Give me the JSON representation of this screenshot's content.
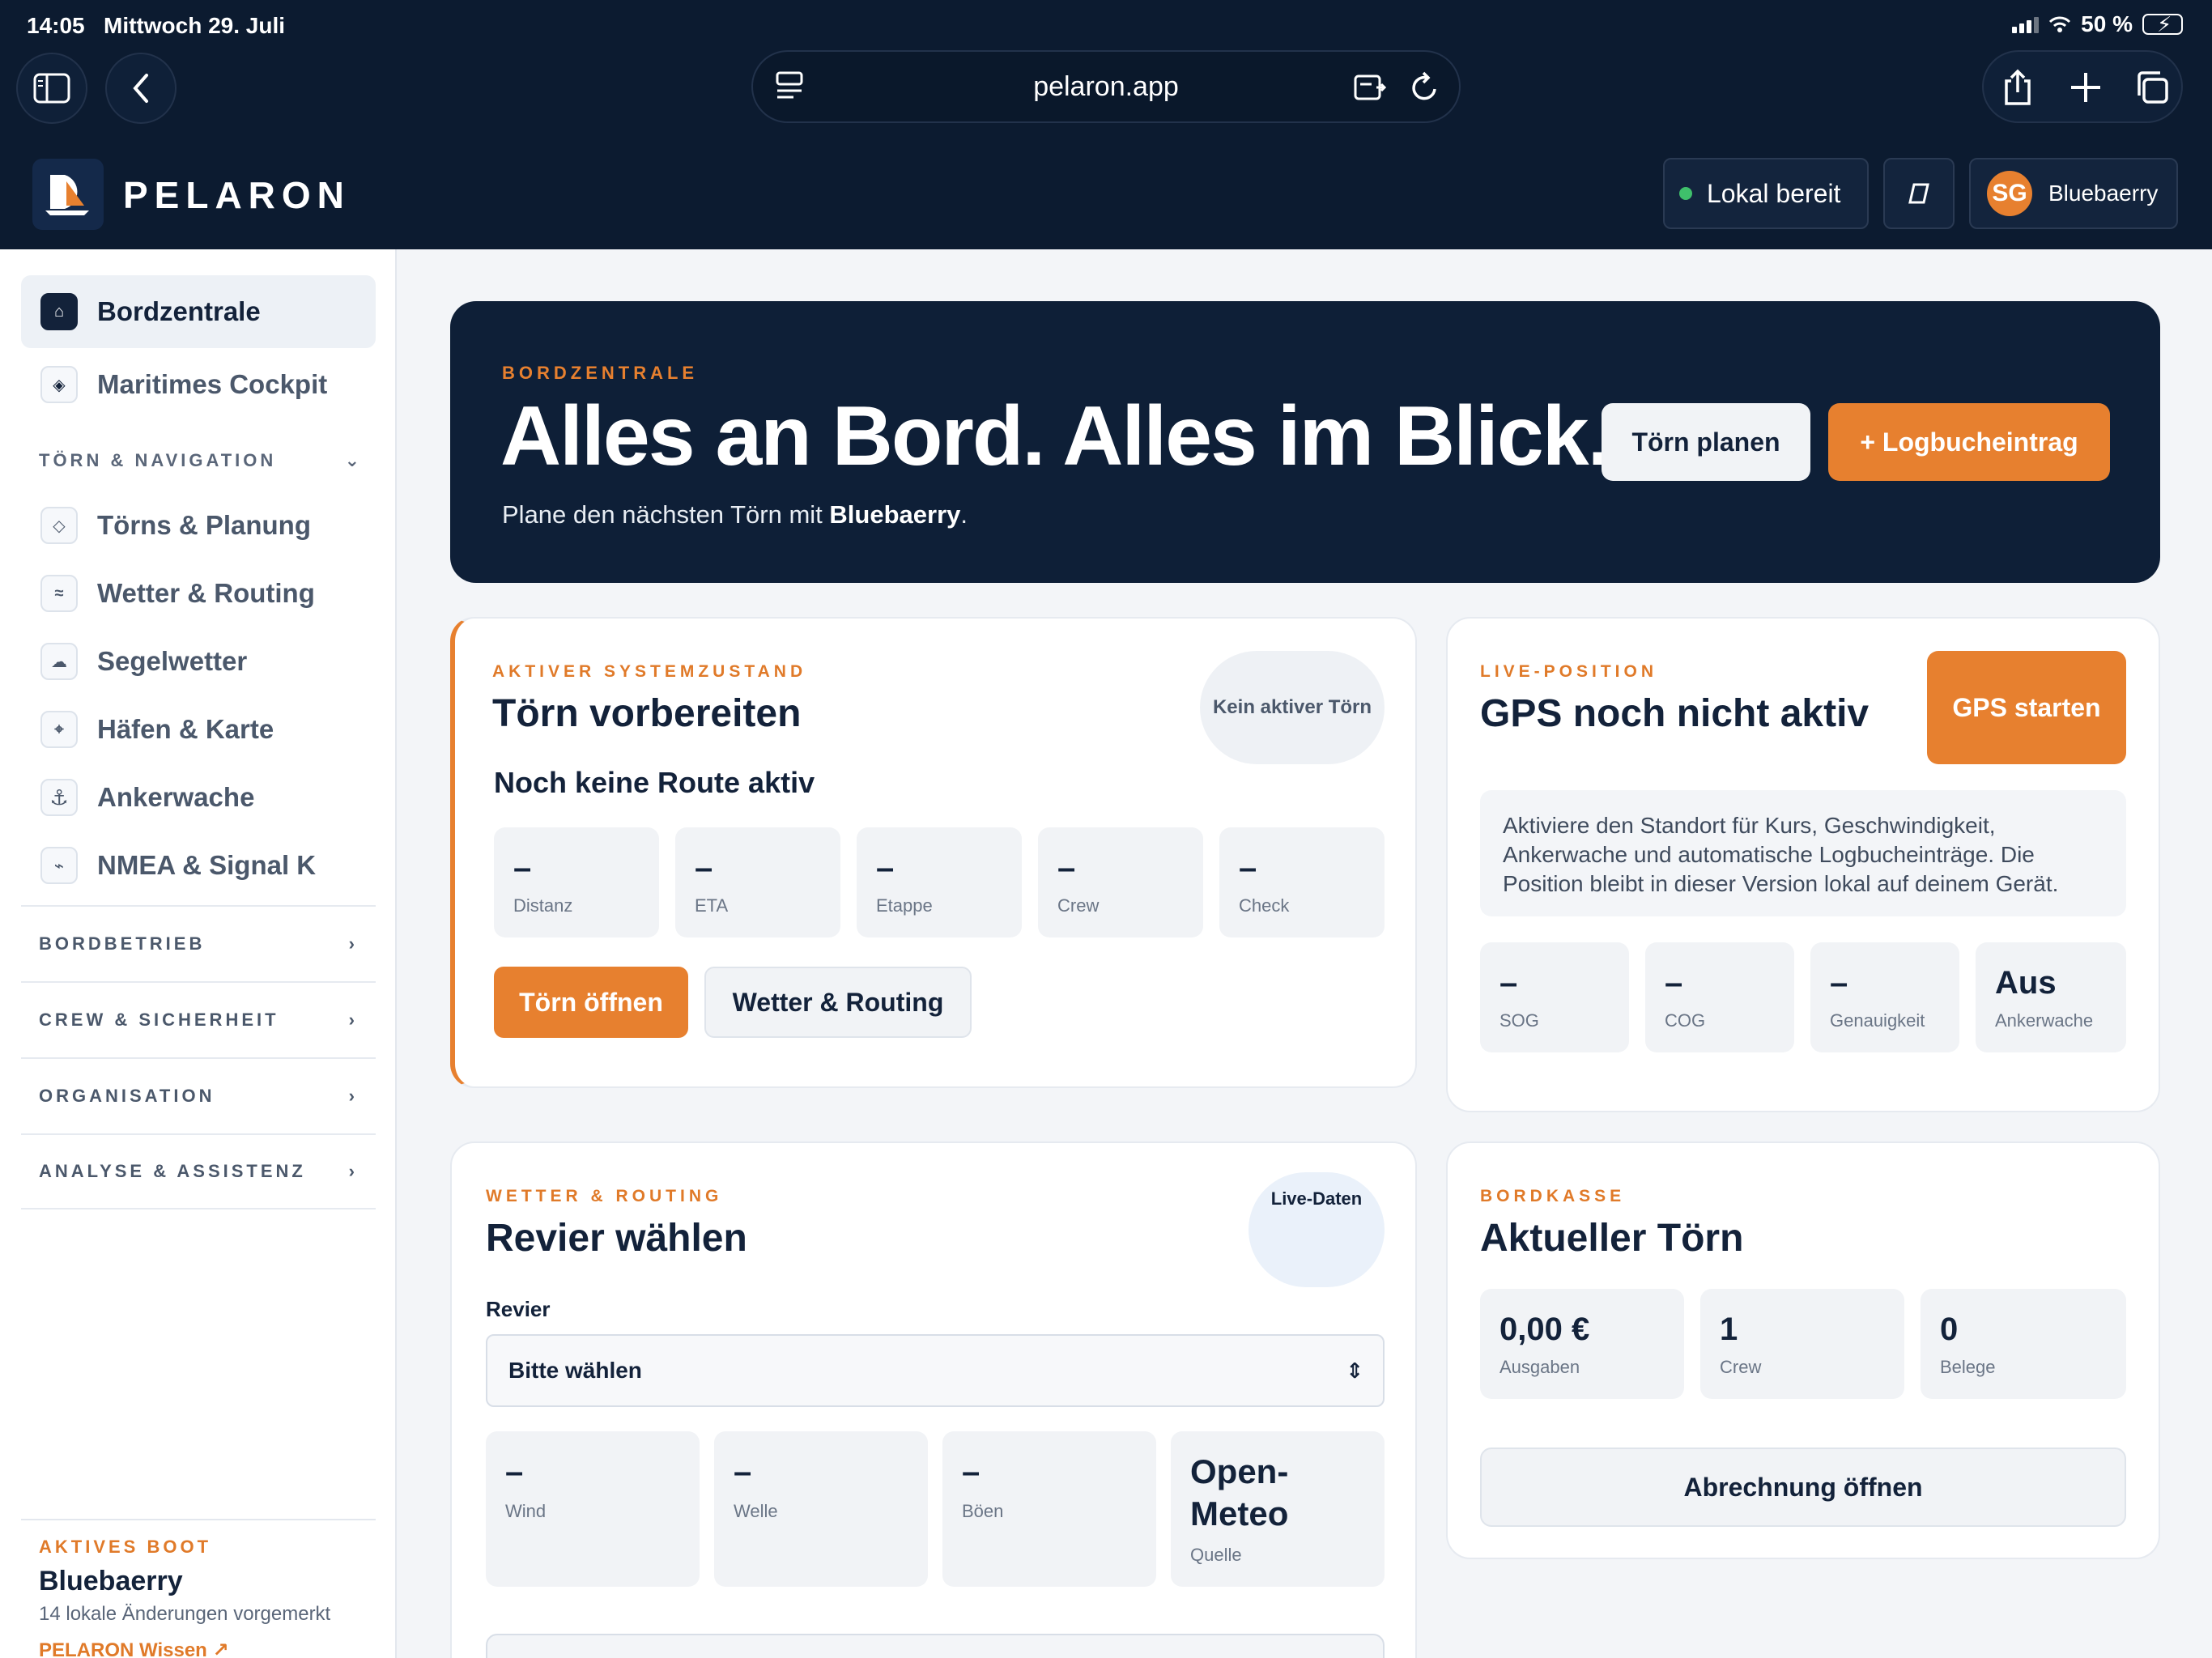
{
  "statusbar": {
    "time": "14:05",
    "date": "Mittwoch 29. Juli",
    "battery": "50 %"
  },
  "browser": {
    "url": "pelaron.app"
  },
  "app": {
    "brand": "PELARON",
    "local_status": "Lokal bereit",
    "user_initials": "SG",
    "user_name": "Bluebaerry"
  },
  "sidebar": {
    "primary": [
      {
        "label": "Bordzentrale",
        "icon": "home-icon"
      },
      {
        "label": "Maritimes Cockpit",
        "icon": "compass-icon"
      }
    ],
    "section_toern": "TÖRN & NAVIGATION",
    "toern_items": [
      {
        "label": "Törns & Planung",
        "icon": "diamond-icon"
      },
      {
        "label": "Wetter & Routing",
        "icon": "wind-icon"
      },
      {
        "label": "Segelwetter",
        "icon": "cloud-icon"
      },
      {
        "label": "Häfen & Karte",
        "icon": "crosshair-icon"
      },
      {
        "label": "Ankerwache",
        "icon": "anchor-icon"
      },
      {
        "label": "NMEA & Signal K",
        "icon": "signal-icon"
      }
    ],
    "sections": [
      "BORDBETRIEB",
      "CREW & SICHERHEIT",
      "ORGANISATION",
      "ANALYSE & ASSISTENZ"
    ],
    "active_boat_label": "AKTIVES BOOT",
    "active_boat_name": "Bluebaerry",
    "active_boat_changes": "14 lokale Änderungen vorgemerkt",
    "wiki_link": "PELARON Wissen ↗"
  },
  "hero": {
    "kicker": "BORDZENTRALE",
    "title": "Alles an Bord. Alles im Blick.",
    "subtitle_prefix": "Plane den nächsten Törn mit ",
    "subtitle_boat": "Bluebaerry",
    "subtitle_suffix": ".",
    "btn_plan": "Törn planen",
    "btn_log": "+ Logbucheintrag"
  },
  "system_card": {
    "kicker": "AKTIVER SYSTEMZUSTAND",
    "title": "Törn vorbereiten",
    "badge": "Kein aktiver Törn",
    "subtitle": "Noch keine Route aktiv",
    "stats": [
      {
        "value": "–",
        "label": "Distanz"
      },
      {
        "value": "–",
        "label": "ETA"
      },
      {
        "value": "–",
        "label": "Etappe"
      },
      {
        "value": "–",
        "label": "Crew"
      },
      {
        "value": "–",
        "label": "Check"
      }
    ],
    "btn_open": "Törn öffnen",
    "btn_weather": "Wetter & Routing"
  },
  "gps_card": {
    "kicker": "LIVE-POSITION",
    "title": "GPS noch nicht aktiv",
    "btn_start": "GPS starten",
    "info": "Aktiviere den Standort für Kurs, Geschwindigkeit, Ankerwache und automatische Logbucheinträge. Die Position bleibt in dieser Version lokal auf deinem Gerät.",
    "stats": [
      {
        "value": "–",
        "label": "SOG"
      },
      {
        "value": "–",
        "label": "COG"
      },
      {
        "value": "–",
        "label": "Genauigkeit"
      },
      {
        "value": "Aus",
        "label": "Ankerwache"
      }
    ]
  },
  "weather_card": {
    "kicker": "WETTER & ROUTING",
    "title": "Revier wählen",
    "badge": "Live-Daten",
    "field_label": "Revier",
    "select_value": "Bitte wählen",
    "stats": [
      {
        "value": "–",
        "label": "Wind"
      },
      {
        "value": "–",
        "label": "Welle"
      },
      {
        "value": "–",
        "label": "Böen"
      },
      {
        "value": "Open-\nMeteo",
        "label": "Quelle"
      }
    ]
  },
  "cash_card": {
    "kicker": "BORDKASSE",
    "title": "Aktueller Törn",
    "stats": [
      {
        "value": "0,00 €",
        "label": "Ausgaben"
      },
      {
        "value": "1",
        "label": "Crew"
      },
      {
        "value": "0",
        "label": "Belege"
      }
    ],
    "btn": "Abrechnung öffnen"
  }
}
